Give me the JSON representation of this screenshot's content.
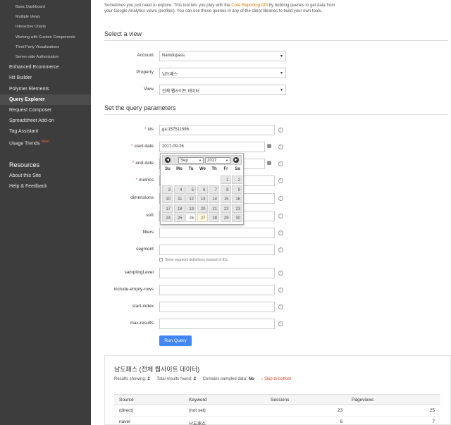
{
  "sidebar": {
    "sub_items": [
      "Basic Dashboard",
      "Multiple Views",
      "Interactive Charts",
      "Working with Custom Components",
      "Third Party Visualizations",
      "Server-side Authorization"
    ],
    "items": [
      "Enhanced Ecommerce",
      "Hit Builder",
      "Polymer Elements",
      "Query Explorer",
      "Request Composer",
      "Spreadsheet Add-on",
      "Tag Assistant",
      "Usage Trends"
    ],
    "new_badge": "New!",
    "resources_heading": "Resources",
    "resources": [
      "About this Site",
      "Help & Feedback"
    ]
  },
  "intro": {
    "text_before": "Sometimes you just need to explore. This tool lets you play with the ",
    "link": "Core Reporting API",
    "text_after": " by building queries to get data from your Google Analytics views (profiles). You can use these queries in any of the client libraries to build your own tools."
  },
  "select_view": {
    "title": "Select a view",
    "account_label": "Account",
    "account_value": "Namdopass",
    "property_label": "Property",
    "property_value": "남도패스",
    "view_label": "View",
    "view_value": "전체 웹사이트 데이터"
  },
  "query": {
    "title": "Set the query parameters",
    "ids_label": "ids",
    "ids_value": "ga:157511596",
    "start_date_label": "start-date",
    "start_date_value": "2017-09-26",
    "end_date_label": "end-date",
    "metrics_label": "metrics",
    "dimensions_label": "dimensions",
    "sort_label": "sort",
    "filters_label": "filters",
    "segment_label": "segment",
    "segment_note": "Show segment definitions instead of IDs.",
    "samplingLevel_label": "samplingLevel",
    "include_empty_label": "include-empty-rows",
    "start_index_label": "start-index",
    "max_results_label": "max-results",
    "run_button": "Run Query"
  },
  "datepicker": {
    "month": "Sep",
    "year": "2017",
    "dow": [
      "Su",
      "Mo",
      "Tu",
      "We",
      "Th",
      "Fr",
      "Sa"
    ],
    "weeks": [
      [
        "",
        "",
        "",
        "",
        "",
        "1",
        "2"
      ],
      [
        "3",
        "4",
        "5",
        "6",
        "7",
        "8",
        "9"
      ],
      [
        "10",
        "11",
        "12",
        "13",
        "14",
        "15",
        "16"
      ],
      [
        "17",
        "18",
        "19",
        "20",
        "21",
        "22",
        "23"
      ],
      [
        "24",
        "25",
        "26",
        "27",
        "28",
        "29",
        "30"
      ]
    ],
    "selected": "26",
    "today": "27"
  },
  "results": {
    "title": "남도패스 (전체 웹사이트 데이터)",
    "showing_label": "Results showing:",
    "showing_value": "2",
    "total_label": "Total results found:",
    "total_value": "2",
    "sampled_label": "Contains sampled data:",
    "sampled_value": "No",
    "skip_link": "Skip to bottom",
    "columns": [
      "Source",
      "Keyword",
      "Sessions",
      "Pageviews"
    ],
    "rows": [
      [
        "(direct)",
        "(not set)",
        "23",
        "25"
      ],
      [
        "naver",
        "남도패스",
        "6",
        "7"
      ]
    ]
  }
}
